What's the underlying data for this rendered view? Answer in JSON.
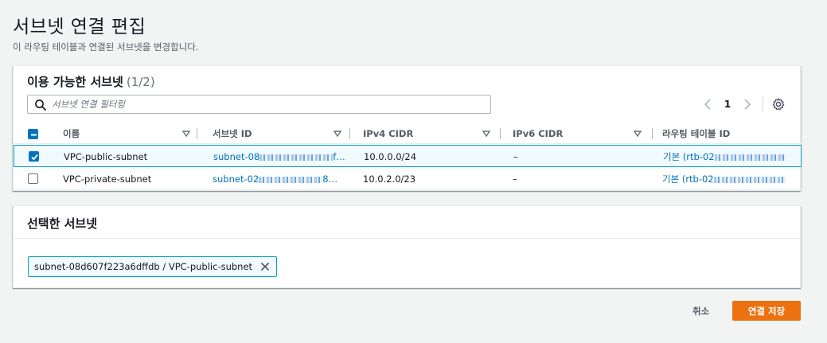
{
  "page": {
    "title": "서브넷 연결 편집",
    "description": "이 라우팅 테이블과 연결된 서브넷을 변경합니다."
  },
  "available": {
    "heading": "이용 가능한 서브넷",
    "count": "(1/2)",
    "search_placeholder": "서브넷 연결 필터링",
    "current_page": "1",
    "columns": [
      "이름",
      "서브넷 ID",
      "IPv4 CIDR",
      "IPv6 CIDR",
      "라우팅 테이블 ID"
    ],
    "rows": [
      {
        "checked": true,
        "name": "VPC-public-subnet",
        "subnet_id": "subnet-08",
        "subnet_suffix": "f…",
        "ipv4": "10.0.0.0/24",
        "ipv6": "–",
        "route_table": "기본 (rtb-02"
      },
      {
        "checked": false,
        "name": "VPC-private-subnet",
        "subnet_id": "subnet-02",
        "subnet_suffix": "8…",
        "ipv4": "10.0.2.0/23",
        "ipv6": "–",
        "route_table": "기본 (rtb-02"
      }
    ]
  },
  "selected": {
    "heading": "선택한 서브넷",
    "token": "subnet-08d607f223a6dffdb / VPC-public-subnet"
  },
  "actions": {
    "cancel": "취소",
    "save": "연결 저장"
  },
  "colors": {
    "accent": "#0073bb",
    "primary_button": "#ec7211",
    "selection_border": "#00a1c9"
  }
}
